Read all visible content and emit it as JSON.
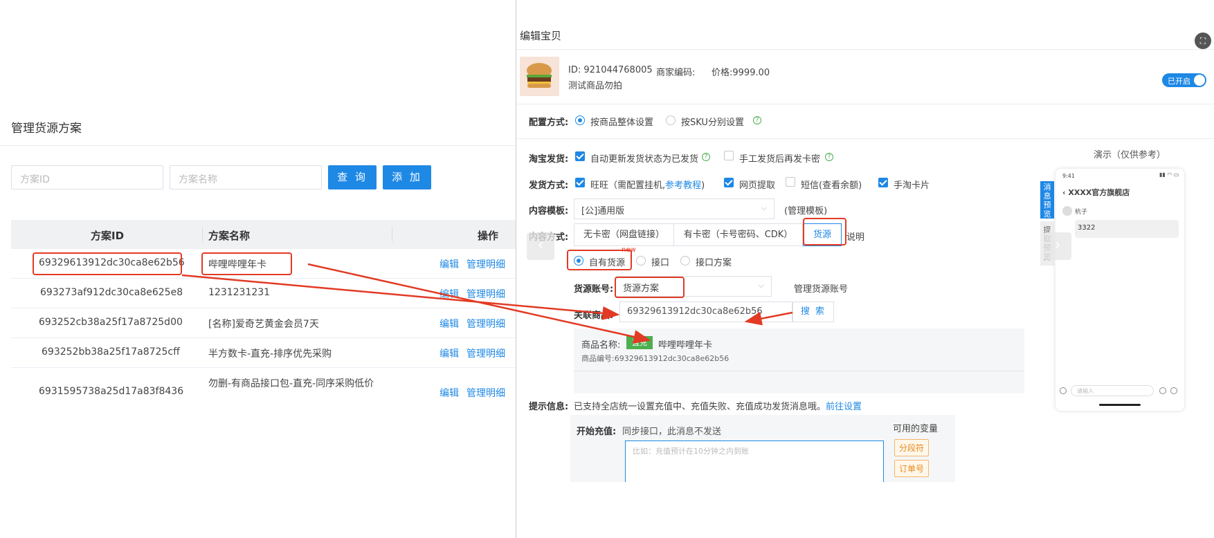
{
  "left": {
    "title": "管理货源方案",
    "search": {
      "id_placeholder": "方案ID",
      "name_placeholder": "方案名称",
      "query_label": "查 询",
      "add_label": "添 加"
    },
    "table": {
      "headers": [
        "方案ID",
        "方案名称",
        "操作"
      ],
      "rows": [
        {
          "id": "69329613912dc30ca8e62b56",
          "name": "哔哩哔哩年卡",
          "edit": "编辑",
          "manage": "管理明细"
        },
        {
          "id": "693273af912dc30ca8e625e8",
          "name": "1231231231",
          "edit": "编辑",
          "manage": "管理明细"
        },
        {
          "id": "693252cb38a25f17a8725d00",
          "name": "[名称]爱奇艺黄金会员7天",
          "edit": "编辑",
          "manage": "管理明细"
        },
        {
          "id": "693252bb38a25f17a8725cff",
          "name": "半方数卡-直充-排序优先采购",
          "edit": "编辑",
          "manage": "管理明细"
        },
        {
          "id": "6931595738a25d17a83f8436",
          "name": "勿删-有商品接口包-直充-同序采购低价",
          "edit": "编辑",
          "manage": "管理明细"
        }
      ]
    }
  },
  "right": {
    "title": "编辑宝贝",
    "product": {
      "id_label": "ID:",
      "id": "921044768005",
      "code_label": "商家编码:",
      "price_label": "价格:",
      "price": "9999.00",
      "name": "测试商品勿拍",
      "toggle": "已开启"
    },
    "config": {
      "label": "配置方式:",
      "opt1": "按商品整体设置",
      "opt2": "按SKU分别设置"
    },
    "taobao": {
      "label": "淘宝发货:",
      "opt1": "自动更新发货状态为已发货",
      "opt2": "手工发货后再发卡密"
    },
    "ship": {
      "label": "发货方式:",
      "wangwang": "旺旺（需配置挂机,",
      "ref": "参考教程",
      "close": ")",
      "web": "网页提取",
      "sms": "短信",
      "sms_link": "(查看余额)",
      "card": "手淘卡片"
    },
    "template": {
      "label": "内容模板:",
      "value": "[公]通用版",
      "manage": "(管理模板)"
    },
    "content": {
      "label": "内容方式:",
      "tab1": "无卡密（网盘链接）",
      "tab2": "有卡密（卡号密码、CDK）",
      "tab3": "货源",
      "help": "说明"
    },
    "source": {
      "opt1": "自有货源",
      "new_badge": "new",
      "opt2": "接口",
      "opt3": "接口方案"
    },
    "account": {
      "label": "货源账号:",
      "value": "货源方案",
      "manage": "管理货源账号"
    },
    "linked": {
      "label": "关联商品:",
      "value": "69329613912dc30ca8e62b56",
      "search": "搜 索"
    },
    "result": {
      "name_label": "商品名称:",
      "badge": "直充",
      "name": "哔哩哔哩年卡",
      "code_label": "商品编号:",
      "code": "69329613912dc30ca8e62b56"
    },
    "tips": {
      "label": "提示信息:",
      "text": "已支持全店统一设置充值中、充值失败、充值成功发货消息哦。",
      "link": "前往设置"
    },
    "recharge": {
      "label": "开始充值:",
      "text": "同步接口，此消息不发送",
      "placeholder": "比如：充值预计在10分钟之内到账",
      "vars_title": "可用的变量",
      "var1": "分段符",
      "var2": "订单号"
    },
    "demo": {
      "title": "演示（仅供参考）",
      "tab1": "消息预览",
      "tab2": "提取预览",
      "time": "9:41",
      "shop": "XXXX官方旗舰店",
      "user": "杭子",
      "msg": "3322",
      "input_ph": "请输入"
    }
  },
  "colors": {
    "accent": "#1e88e5",
    "annotation": "#e23a24",
    "green": "#4caf50"
  }
}
